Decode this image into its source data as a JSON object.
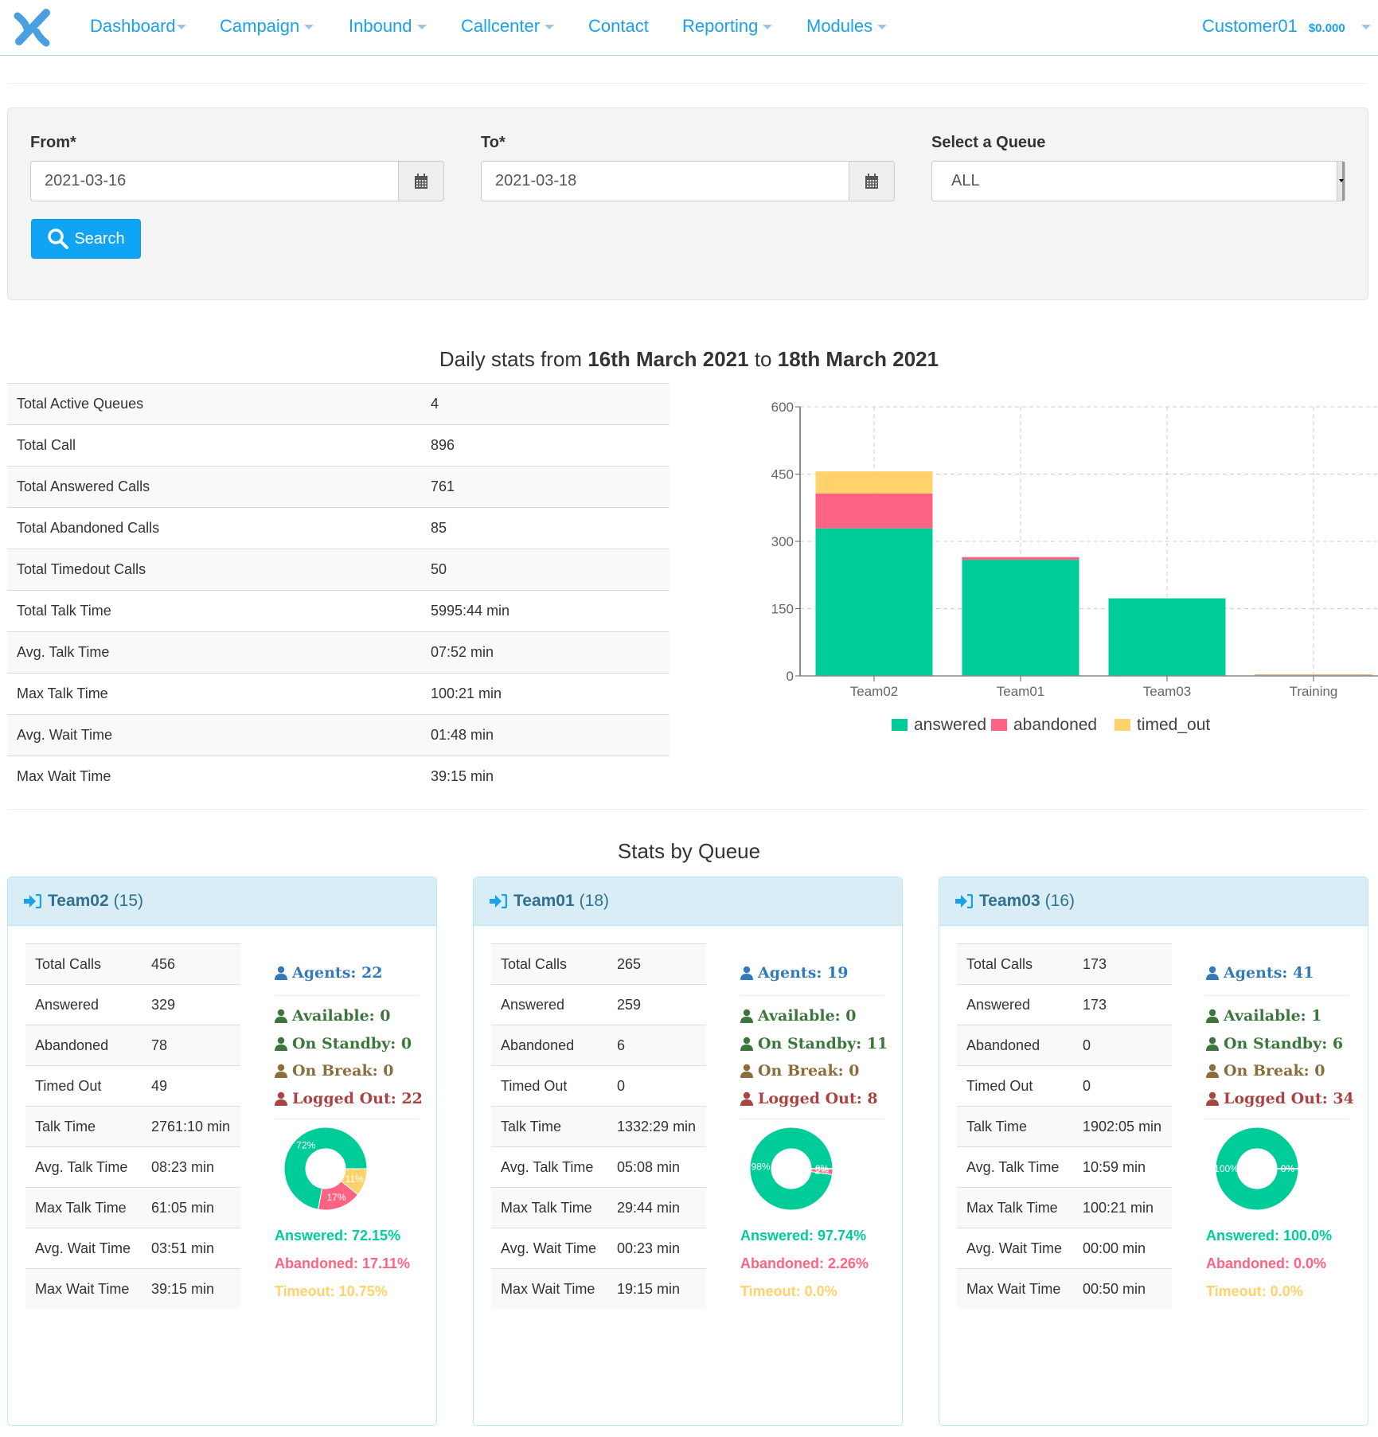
{
  "nav": {
    "items": [
      {
        "label": "Dashboard",
        "caret": true
      },
      {
        "label": "Campaign",
        "caret": true
      },
      {
        "label": "Inbound",
        "caret": true
      },
      {
        "label": "Callcenter",
        "caret": true
      },
      {
        "label": "Contact",
        "caret": false
      },
      {
        "label": "Reporting",
        "caret": true
      },
      {
        "label": "Modules",
        "caret": true
      }
    ],
    "user": "Customer01",
    "balance": "$0.000",
    "accent": "#1aa1ea"
  },
  "filter": {
    "from_label": "From*",
    "from_value": "2021-03-16",
    "to_label": "To*",
    "to_value": "2021-03-18",
    "queue_label": "Select a Queue",
    "queue_value": "ALL",
    "search_label": "Search"
  },
  "daily": {
    "title_prefix": "Daily stats from ",
    "date_from": "16th March 2021",
    "title_mid": " to ",
    "date_to": "18th March 2021",
    "rows": [
      {
        "label": "Total Active Queues",
        "value": "4"
      },
      {
        "label": "Total Call",
        "value": "896"
      },
      {
        "label": "Total Answered Calls",
        "value": "761"
      },
      {
        "label": "Total Abandoned Calls",
        "value": "85"
      },
      {
        "label": "Total Timedout Calls",
        "value": "50"
      },
      {
        "label": "Total Talk Time",
        "value": "5995:44 min"
      },
      {
        "label": "Avg. Talk Time",
        "value": "07:52 min"
      },
      {
        "label": "Max Talk Time",
        "value": "100:21 min"
      },
      {
        "label": "Avg. Wait Time",
        "value": "01:48 min"
      },
      {
        "label": "Max Wait Time",
        "value": "39:15 min"
      }
    ]
  },
  "chart_data": {
    "type": "bar",
    "stacked": true,
    "title": "",
    "xlabel": "",
    "ylabel": "",
    "categories": [
      "Team02",
      "Team01",
      "Team03",
      "Training"
    ],
    "series": [
      {
        "name": "answered",
        "color": "#00cc99",
        "values": [
          329,
          259,
          173,
          0
        ]
      },
      {
        "name": "abandoned",
        "color": "#ff6384",
        "values": [
          78,
          6,
          0,
          0
        ]
      },
      {
        "name": "timed_out",
        "color": "#ffd26b",
        "values": [
          49,
          0,
          0,
          0
        ]
      }
    ],
    "ylim": [
      0,
      600
    ],
    "yticks": [
      0,
      150,
      300,
      450,
      600
    ],
    "grid": true,
    "legend": "bottom"
  },
  "queues_title": "Stats by Queue",
  "labels": {
    "total_calls": "Total Calls",
    "answered": "Answered",
    "abandoned": "Abandoned",
    "timed_out": "Timed Out",
    "talk_time": "Talk Time",
    "avg_talk": "Avg. Talk Time",
    "max_talk": "Max Talk Time",
    "avg_wait": "Avg. Wait Time",
    "max_wait": "Max Wait Time"
  },
  "colors": {
    "agents": "#337ab7",
    "available": "#3c763d",
    "standby": "#3c763d",
    "break": "#8a6d3b",
    "logged_out": "#a94442",
    "answered": "#00cc99",
    "abandoned": "#ff6384",
    "timeout": "#ffd26b"
  },
  "queues": [
    {
      "name": "Team02",
      "count": "(15)",
      "stats": [
        "456",
        "329",
        "78",
        "49",
        "2761:10 min",
        "08:23 min",
        "61:05 min",
        "03:51 min",
        "39:15 min"
      ],
      "agents": "Agents: 22",
      "available": "Available: 0",
      "standby": "On Standby: 0",
      "on_break": "On Break: 0",
      "logged_out": "Logged Out: 22",
      "donut": [
        {
          "name": "answered",
          "value": 329,
          "label": "72%"
        },
        {
          "name": "abandoned",
          "value": 78,
          "label": "17%"
        },
        {
          "name": "timed_out",
          "value": 49,
          "label": "11%"
        }
      ],
      "answered_pct": "Answered: 72.15%",
      "abandoned_pct": "Abandoned: 17.11%",
      "timeout_pct": "Timeout: 10.75%"
    },
    {
      "name": "Team01",
      "count": "(18)",
      "stats": [
        "265",
        "259",
        "6",
        "0",
        "1332:29 min",
        "05:08 min",
        "29:44 min",
        "00:23 min",
        "19:15 min"
      ],
      "agents": "Agents: 19",
      "available": "Available: 0",
      "standby": "On Standby: 11",
      "on_break": "On Break: 0",
      "logged_out": "Logged Out: 8",
      "donut": [
        {
          "name": "answered",
          "value": 259,
          "label": "98%"
        },
        {
          "name": "abandoned",
          "value": 6,
          "label": "2%"
        },
        {
          "name": "timed_out",
          "value": 0,
          "label": "0%"
        }
      ],
      "answered_pct": "Answered: 97.74%",
      "abandoned_pct": "Abandoned: 2.26%",
      "timeout_pct": "Timeout: 0.0%"
    },
    {
      "name": "Team03",
      "count": "(16)",
      "stats": [
        "173",
        "173",
        "0",
        "0",
        "1902:05 min",
        "10:59 min",
        "100:21 min",
        "00:00 min",
        "00:50 min"
      ],
      "agents": "Agents: 41",
      "available": "Available: 1",
      "standby": "On Standby: 6",
      "on_break": "On Break: 0",
      "logged_out": "Logged Out: 34",
      "donut": [
        {
          "name": "answered",
          "value": 173,
          "label": "100%"
        },
        {
          "name": "abandoned",
          "value": 0,
          "label": "0%"
        },
        {
          "name": "timed_out",
          "value": 0,
          "label": "0%"
        }
      ],
      "answered_pct": "Answered: 100.0%",
      "abandoned_pct": "Abandoned: 0.0%",
      "timeout_pct": "Timeout: 0.0%"
    }
  ]
}
